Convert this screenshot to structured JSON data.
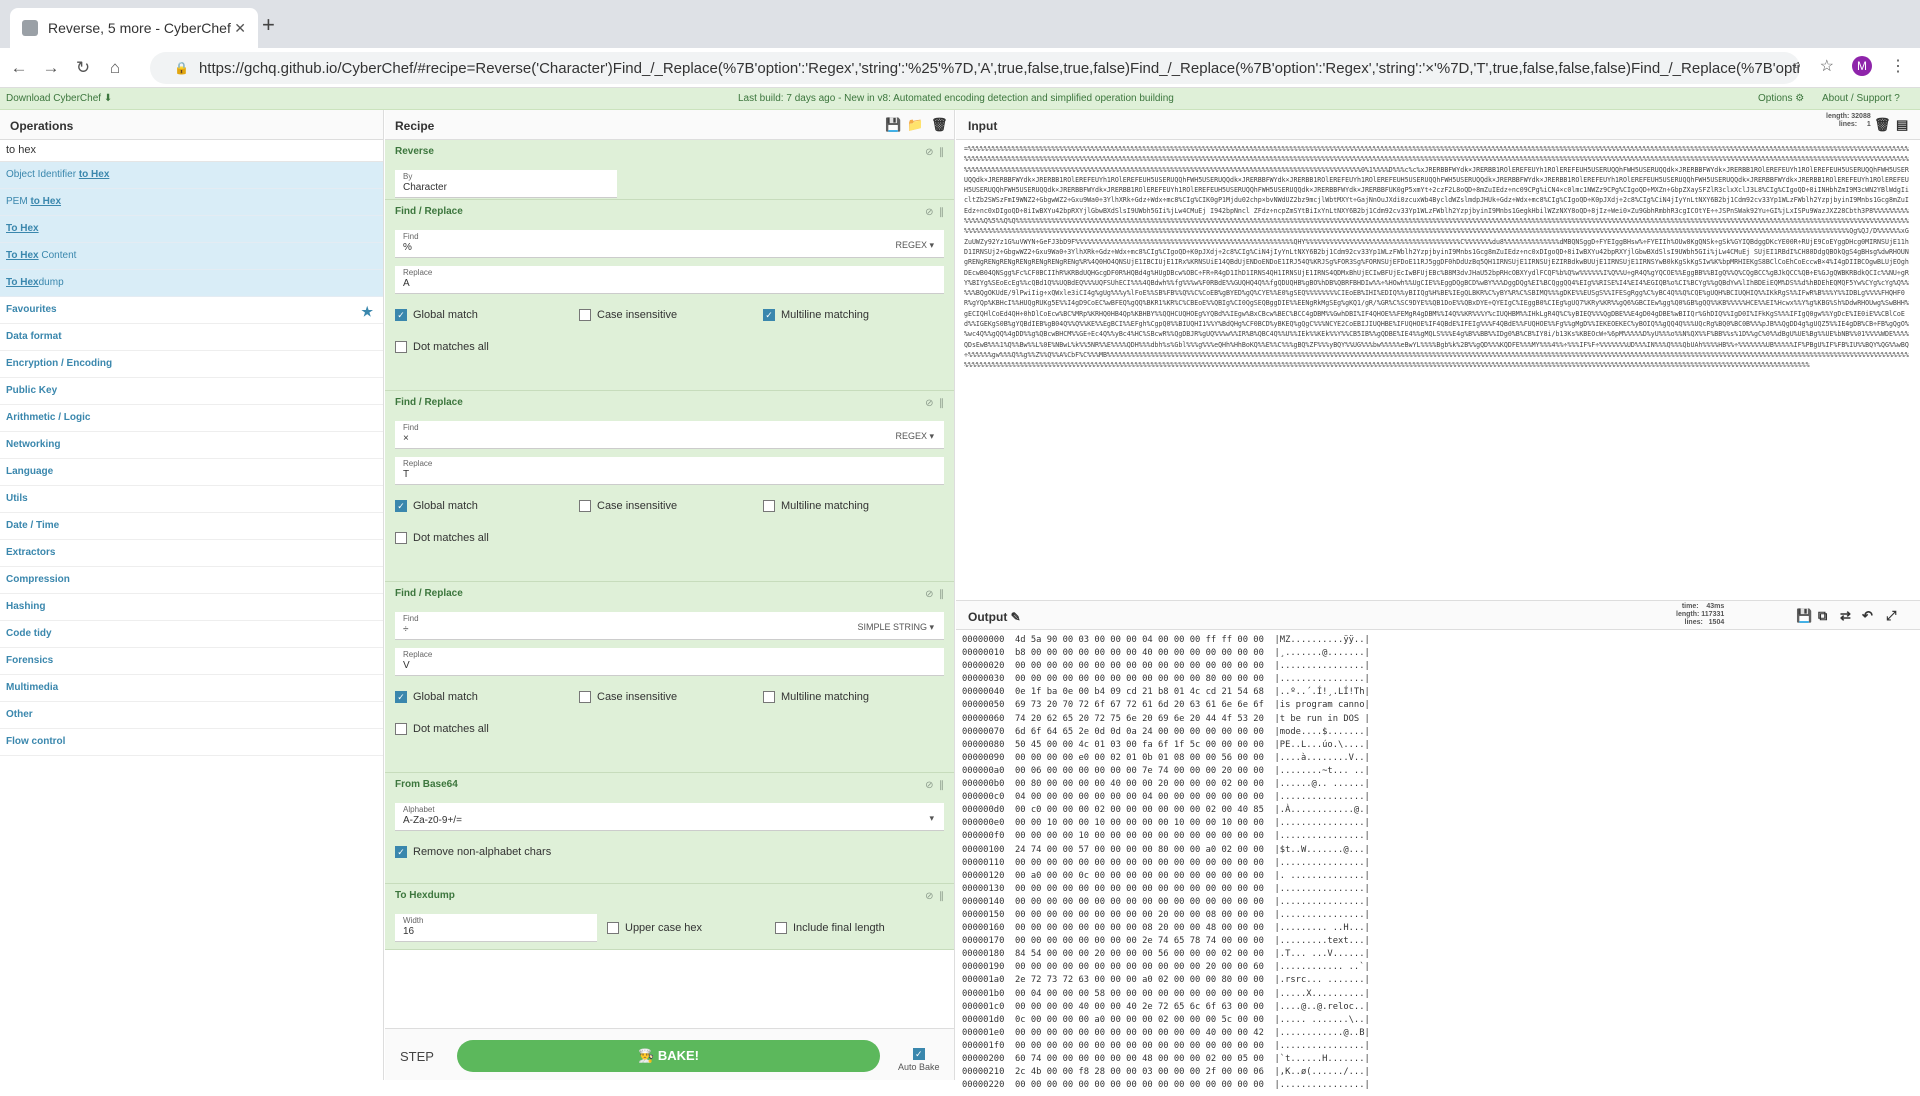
{
  "browser": {
    "tab_title": "Reverse, 5 more - CyberChef",
    "url": "https://gchq.github.io/CyberChef/#recipe=Reverse('Character')Find_/_Replace(%7B'option':'Regex','string':'%25'%7D,'A',true,false,true,false)Find_/_Replace(%7B'option':'Regex','string':'×'%7D,'T',true,false,false,false)Find_/_Replace(%7B'option':'Si...",
    "avatar": "M"
  },
  "banner": {
    "download": "Download CyberChef",
    "build": "Last build: 7 days ago - New in v8: Automated encoding detection and simplified operation building",
    "options": "Options",
    "about": "About / Support"
  },
  "operations": {
    "title": "Operations",
    "search": "to hex",
    "results": [
      {
        "pre": "Object Identifier ",
        "match": "to Hex",
        "post": ""
      },
      {
        "pre": "PEM ",
        "match": "to Hex",
        "post": ""
      },
      {
        "pre": "",
        "match": "To Hex",
        "post": ""
      },
      {
        "pre": "",
        "match": "To Hex",
        "post": " Content"
      },
      {
        "pre": "",
        "match": "To Hex",
        "post": "dump"
      }
    ],
    "categories": [
      "Favourites",
      "Data format",
      "Encryption / Encoding",
      "Public Key",
      "Arithmetic / Logic",
      "Networking",
      "Language",
      "Utils",
      "Date / Time",
      "Extractors",
      "Compression",
      "Hashing",
      "Code tidy",
      "Forensics",
      "Multimedia",
      "Other",
      "Flow control"
    ]
  },
  "recipe": {
    "title": "Recipe",
    "op_reverse": {
      "name": "Reverse",
      "by_label": "By",
      "by_value": "Character"
    },
    "fr1": {
      "name": "Find / Replace",
      "find_label": "Find",
      "find": "%",
      "mode": "REGEX",
      "replace_label": "Replace",
      "replace": "A",
      "global": "Global match",
      "case": "Case insensitive",
      "multi": "Multiline matching",
      "dot": "Dot matches all"
    },
    "fr2": {
      "name": "Find / Replace",
      "find_label": "Find",
      "find": "×",
      "mode": "REGEX",
      "replace_label": "Replace",
      "replace": "T",
      "global": "Global match",
      "case": "Case insensitive",
      "multi": "Multiline matching",
      "dot": "Dot matches all"
    },
    "fr3": {
      "name": "Find / Replace",
      "find_label": "Find",
      "find": "÷",
      "mode": "SIMPLE STRING",
      "replace_label": "Replace",
      "replace": "V",
      "global": "Global match",
      "case": "Case insensitive",
      "multi": "Multiline matching",
      "dot": "Dot matches all"
    },
    "b64": {
      "name": "From Base64",
      "alpha_label": "Alphabet",
      "alpha": "A-Za-z0-9+/=",
      "remove": "Remove non-alphabet chars"
    },
    "hexd": {
      "name": "To Hexdump",
      "width_label": "Width",
      "width": "16",
      "upper": "Upper case hex",
      "final": "Include final length"
    },
    "step": "STEP",
    "bake": "BAKE!",
    "autobake": "Auto Bake"
  },
  "input": {
    "title": "Input",
    "meta": "length: 32088\nlines:     1",
    "text": "=%%%%%%%%%%%%%%%%%%%%%%%%%%%%%%%%%%%%%%%%%%%%%%%%%%%%%%%%%%%%%%%%%%%%%%%%%%%%%%%%%%%%%%%%%%%%%%%%%%%%%%%%%%%%%%%%%%%%%%%%%%%%%%%%%%%%%%%%%%%%%%%%%%%%%%%%%%%%%%%%%%%%%%%%%%%%%%%%%%%%%%%%%%%%%%%%%%%%%%%%%%%%%%%%%%%%%%%%%%%%%%%%%%%%%%%%%%%%%%%%%%%%%%%%%%%%%%%%%%%%%%%%%%%%%%%%%%%%%%%%%%%%%%%%%%%%%%%%%%%%%%%%%%%%%%%%%%%%%%%%%%%%%%%%%%%%%%%%%%%%%%%%%%%%%%%%%%%%%%%%%%%%%%%%%%%%%%%%%%%%%%%%%%%%%%%%%%%%%%%%%%%%%%%%%%%%%%%%%%%%%%%%%%%%%%%%%%%%%%%%%%%%%%%%%%%%%%%%%%%%%%%%%%%%%%%%%%%%%%%%%%%%%%%%%%%%%%%%%%%%%%%%%%%%%%%%%%%%%%%%%%%%%%%%%%%%%%%%%%%%%%%%%%%%%%%%%%%%%%%%%%%%%%%%%%%%%%%0%1%%%%D%%%c%c%xJRERBBFWYdk×JRERBB1ROlEREFEUYh1ROlEREFEUH5USERUQQhFWH5USERUQQdk×JRERBBFWYdk×JRERBB1ROlEREFEUYh1ROlEREFEUH5USERUQQhFWH5USERUQQdk×JRERBBFWYdk×JRERBB1ROlEREFEUYh1ROlEREFEUH5USERUQQhFWH5USERUQQdk×JRERBBFWYdk×JRERBB1ROlEREFEUYh1ROlEREFEUH5USERUQQhFWH5USERUQQdk×JRERBBFWYdk×JRERBB1ROlEREFEUYh1ROlEREFEUH5USERUQQhFWH5USERUQQdk×JRERBBFWYdk×JRERBB1ROlEREFEUYh1ROlEREFEUH5USERUQQhFWH5USERUQQdk×JRERBBFWYdk×JRERBB1ROlEREFEUYh1ROlEREFEUH5USERUQQhFWH5USERUQQdk×JRERBBFWYdk×JRERBBFUK0gP5xmYt÷2czF2L8oQD÷8mZuIEdz÷nc09CPg%iCN4×c0lmc1NWZz9CPg%CIgoQD÷MXZn÷GbpZXaySFZlR3clxXclJ3L8%CIg%CIgoQD÷8iINHbhZmI9M3cWN2YBlWdgIicltZb2SWSzFmI9WNZ2÷GbgwWZ2÷Gxu9Wa0÷3YlhXRk÷Gdz÷Wdx÷mc8%CIg%CIK0gP1Mjdu02chp×bvNWdUZ2bz9mcjlWbtMXYt÷GajNnOuJXdi0zcuxWb4BycldWZslmdpJHUk÷Gdz÷Wdx÷mc8%CIg%CIgoQD÷K0pJXdj÷2c8%CIg%CiN4jIyYnLtNXY6B2bj1Cdm92cv33Yp1WLzFWblh2YzpjbyinI9Mnbs1Gcg8mZuIEdz÷nc0xDIgoQD÷8iIwBXYu42bpRXYjlGbwBXdSlsI9UWbh5GIi%jLw4CMuEj I942bpNncl ZFdz÷ncpZmSYtBiIxYnLtNXY6B2bj1Cdm92cv33Yp1WLzFWblh2YzpjbyinI9Mnbs1GegkHbilWZzNXY8oQD÷8jIz÷Wei0×Zu9GbhRmbhR3cgICOtYE÷÷JSPnSWak92Yu÷GI%jLxISPu9WazJXZ28Cbth3P8%%%%%%%%%%%%%%Q%5%%Q%Q%%%%%%%%%%%%%%%%%%%%%%%%%%%%%%%%%%%%%%%%%%%%%%%%%%%%%%%%%%%%%%%%%%%%%%%%%%%%%%%%%%%%%%%%%%%%%%%%%%%%%%%%%%%%%%%%%%%%%%%%%%%%%%%%%%%%%%%%%%%%%%%%%%%%%%%%%%%%%%%%%%%%%%%%%%%%%%%%%%%%%%%%%%%%%%%%%%%%%%%%%%%%%%%%%%%%%%%%%%%%%%%%%%%%%%%%%%%%%%%%%%%%%%%%%%%%%%%%%%%%%%%%%%%%%%%%%%%%%%%%%%%%%%%%%%%%%%%%%%%%%%%%%%%%%%%%%%%%%%%%%%%%%%%%%%%%%%%%%%%%%%%%%%%%%%%%%%%%%%%%%%%%%%%%%%%%%%%%%%%%%%%%%%%%%%%%%%%%%%%%%%%%%%%%%%%%%%%%%%%%%%%%%%%%%%%%%%%%%%%%%%%%%%%%Qg%QJ/D%%%%%%xGZuUWZy92Yz1G%uVWYN÷GeFJ3bD9F%%%%%%%%%%%%%%%%%%%%%%%%%%%%%%%%%%%%%%%%%%%%%%%%%%%%%%%QHY%%%%%%%%%%%%%%%%%%%%%%%%%%%%%%%%%%%%%%%C%%%%%%%du8%%%%%%%%%%%%%%dMBQNSggD÷FYEIggBHsw%÷FYEIIh%OUw8KgQNSk÷gSk%GYIQBdggDKcYE00R÷RUjE9CoEYggDHcg0MIRNSUjE11hD1IRNSUj2÷GbgwWZ2÷Gxu9Wa0÷3YlhXRk÷Gdz÷Wdx÷mc8%CIg%CIgoQD÷K0pJXdj÷2c8%CIg%CiN4jIyYnLtNXY6B2bj1Cdm92cv33Yp1WLzFWblh2YzpjbyinI9Mnbs1Gcg8mZuIEdz÷nc0xDIgoQD÷8iIwBXYu42bpRXYjlGbwBXdSlsI9UWbh5GIi%jLw4CMuEj SUjEI1RBdI%CH80DdgQBOkQgS4gBHsg%dwRHOUNgRENgRENgRENgRENgRENgRENgRENg%R%4Q0HO4QNSUjE1IBCIUjE1IRx%KRNSUiE14QBdUjENDoENDoE1IRJ54Q%KRJSg%FOR3Sg%FORNSUjEFDoE11RJ5ggDF0hDdUzBq5QH1IRNSUjE1IRNSUjEZIRBdkwBUUjE1IRNSUjE1IRNSYwB0kKgSkKgSIw%K%bpMRHIEKgS8BClCoEhCoEccwB×4%I4gDIIBCOgwBLUjEOghDEcwB04QNSgg%Fc%CF0BCIIhR%KRBdUQHGcgDF0R%HQBd4g%HUgDBcw%OBC÷FR÷R4gD1IhD1IRNS4QH1IRNSUjE1IRNS4QDMxBhUjECIwBFUjEcIwBFUjEBc%B8M3dvJHaU52bpRHcOBXYydlFCQF%b%Q%w%%%%%%I%Q%%U÷gR4Q%gYQCOE%%EggBB%%BIgQ%%Q%CQgBCC%gBJkQCC%QB÷E%GJgQWBKRBdkQCIc%%NU÷gRY%BIYg%SEoEcEg%%cQBd1Q%%UQBdEQ%%%UQFSUhECI%%%4QBdwh%%fg%%%w%F0RBdE%%GUQHQ4Q%%fgQDUQHB%gBO%hDB%QBRFBHDIw%%÷%HOwh%%UgCIE%%EggDQgBCD%wBY%%%DggDQg%EI%BCQggQQ4%EIg%%RISE%I4%EI4%EGIQB%o%CI%BCYg%%gQBdYw%lIhBDEiEQM%DS%%d%hBDEhEQMQF5Yw%CYg%cYg%Q%%%%%BQgOKUdE/9lPwiIig÷xQWxle3iCI4g%gUg%%%y%lFoE%%SB%FB%%Q%%C%CoEB%gBYED%gQ%CYE%%E0%gSEQ%%%%%%%%CIEoEB%IHI%EDIQ%%yBIIQg%H%BE%IEgQLBKR%C%yBY%R%C%SBIMQ%%%gDKE%%EUSgS%%IFESgRgg%C%yBC4Q%%Q%CQE%gUQH%BCIUQHIQ%%IKkRgS%%IFwR%B%%%Y%%IDBLg%%%%FHQHF0R%gYQp%KBHcI%%HUQgRUKg5E%%I4gD9CoEC%wBFEQ%gQQ%BKR1%KR%C%CBEoE%%QBIg%CI0QgSEQBggDIE%%EENgRkMgSEg%gKQ1/gR/%GR%C%SC9DYE%%QB1DoE%%QBxDYE÷QYEIgC%IEggB0%CIEg%gUQ7%KRy%KR%%gQ6%GBCIEw%gg%Q0%GB%gQQ%%KB%%%%%HCE%%EI%Hcwx%%Y%g%KBG%Sh%DdwRHOUwg%SwBHH%gECIQHlCoEd4QH÷0hDlCoEcw%BC%MRp%KRHQ0HB4Qp%KBHBY%%QQHCUQHOEg%YQBd%%IEgw%BxCBcw%BEC%BCC4gDBM%%GwhDBI%IF4QHOE%%FEMgR4gDBM%%I4Q%%KR%%%Y%cIUQHBM%%IHkLgR4Q%C%yBIEQ%%%QgDBE%%E4gD04gDBE%wBIIQr%GhDIQ%%IgD0I%IFkKgS%%%IFIgQ0gw%%YgDcE%IE0iE%%CBlCoEd%%IGEKgS0B%gYQBdIEB%gB04Q%%Q%%KE%%EgBCI%%EFgh%CgpQ0%%BIUQHI1%%Y%BdQHg%CF0BCD%yBKEQ%gQgC%%%NCYE2CoEBIJIUQHBE%IFUQHOE%IF4QBdE%IFEIg%%%F4QBdE%%FUQHOE%%Fg%%gMgD%%IEKEOEKEC%yBOIQ%%gQQ4Q%%%UQcRg%BQ0%BC0B%%%pJB%%QgDD4g%gUQZ5%%IE4gDB%CB÷FB%gQgO%%wc4Q%%gQQ%4gDD%%g%QBcwBHCM%%GE÷Ec4Q%%yBc4%HC%SBcwR%%QgDBJR%gUQ%%%w%%IR%B%QBC4Q%%U%%IEk%%KEk%%Y%%CB5IB%%gQDBE%IE4%%gMQLS%%%E4g%B%%BB%%IDg0%B%CB%IY8i/b13Ks%KBEOcW÷%6pM%%%%%D%yU%%%o%%N%QX%%F%BB%%s%1D%%gC%0%%dBgU%UE%Bg%%UE%bNB%%01%%%%WDE%%%%QDsEwB%%%1%Q%%Bw%%L%0E%NBwL%k%%5NR%%E%%%%QDH%%%dbh%s%Gbl%%%g%%%eQHh%HhBoKQ%%E%%C%%%gBQ%ZF%%%yBQY%%UG%%%bw%%%%%eBwYL%%%%Bgb%k%2B%%gQD%%%KQDFE%%%MY%%%4%%÷%%%IF%F÷%%%%%%%UD%%%IN%%%Q%%%QbUAh%%%%HB%%÷%%%%%%%UB%%%%%IF%PBgU%IF%FB%IU%%BQY%QG%%wBQ÷%%%%%%gw%%%Q%%g%%Z%%Q%%A%CbF%C%%%MB%%%%%%%%%%%%%%%%%%%%%%%%%%%%%%%%%%%%%%%%%%%%%%%%%%%%%%%%%%%%%%%%%%%%%%%%%%%%%%%%%%%%%%%%%%%%%%%%%%%%%%%%%%%%%%%%%%%%%%%%%%%%%%%%%%%%%%%%%%%%%%%%%%%%%%%%%%%%%%%%%%%%%%%%%%%%%%%%%%%%%%%%%%%%%%%%%%%%%%%%%%%%%%%%%%%%%%%%%%%%%%%%%%%%%%%%%%%%%%%%%%%%%%%%%%%%%%%%%%%%%%%%%%%%%%%%%%%%%%%%%%%%%%%%%%%%%%%%%%%%%%%%%%%%%%%%%%%%%%%%%%%%%%%%%%%%%%%%%%%%%%%%%%%%%%%%%%%%%%%%%%%%%%%%%%%%%%%%%%%%%%%%%%%%%%%%%%%%%%%%%%%%%%%%%%%%%%%"
  },
  "output": {
    "title": "Output",
    "meta": "time:    43ms\nlength: 117331\nlines:   1504",
    "lines": [
      "00000000  4d 5a 90 00 03 00 00 00 04 00 00 00 ff ff 00 00  |MZ..........ÿÿ..|",
      "00000010  b8 00 00 00 00 00 00 00 40 00 00 00 00 00 00 00  |¸.......@.......|",
      "00000020  00 00 00 00 00 00 00 00 00 00 00 00 00 00 00 00  |................|",
      "00000030  00 00 00 00 00 00 00 00 00 00 00 00 80 00 00 00  |................|",
      "00000040  0e 1f ba 0e 00 b4 09 cd 21 b8 01 4c cd 21 54 68  |..º..´.Í!¸.LÍ!Th|",
      "00000050  69 73 20 70 72 6f 67 72 61 6d 20 63 61 6e 6e 6f  |is program canno|",
      "00000060  74 20 62 65 20 72 75 6e 20 69 6e 20 44 4f 53 20  |t be run in DOS |",
      "00000070  6d 6f 64 65 2e 0d 0d 0a 24 00 00 00 00 00 00 00  |mode....$.......|",
      "00000080  50 45 00 00 4c 01 03 00 fa 6f 1f 5c 00 00 00 00  |PE..L...úo.\\....|",
      "00000090  00 00 00 00 e0 00 02 01 0b 01 08 00 00 56 00 00  |....à........V..|",
      "000000a0  00 06 00 00 00 00 00 00 7e 74 00 00 00 20 00 00  |........~t... ..|",
      "000000b0  00 80 00 00 00 00 40 00 00 20 00 00 00 02 00 00  |......@.. ......|",
      "000000c0  04 00 00 00 00 00 00 00 04 00 00 00 00 00 00 00  |................|",
      "000000d0  00 c0 00 00 00 02 00 00 00 00 00 00 02 00 40 85  |.À............@.|",
      "000000e0  00 00 10 00 00 10 00 00 00 00 10 00 00 10 00 00  |................|",
      "000000f0  00 00 00 00 10 00 00 00 00 00 00 00 00 00 00 00  |................|",
      "00000100  24 74 00 00 57 00 00 00 00 80 00 00 a0 02 00 00  |$t..W.......@...|",
      "00000110  00 00 00 00 00 00 00 00 00 00 00 00 00 00 00 00  |................|",
      "00000120  00 a0 00 00 0c 00 00 00 00 00 00 00 00 00 00 00  |. ..............|",
      "00000130  00 00 00 00 00 00 00 00 00 00 00 00 00 00 00 00  |................|",
      "00000140  00 00 00 00 00 00 00 00 00 00 00 00 00 00 00 00  |................|",
      "00000150  00 00 00 00 00 00 00 00 00 20 00 00 08 00 00 00  |................|",
      "00000160  00 00 00 00 00 00 00 00 08 20 00 00 48 00 00 00  |......... ..H...|",
      "00000170  00 00 00 00 00 00 00 00 2e 74 65 78 74 00 00 00  |.........text...|",
      "00000180  84 54 00 00 00 20 00 00 00 56 00 00 00 02 00 00  |.T... ...V......|",
      "00000190  00 00 00 00 00 00 00 00 00 00 00 00 20 00 00 60  |............ ..`|",
      "000001a0  2e 72 73 72 63 00 00 00 a0 02 00 00 00 80 00 00  |.rsrc... .......|",
      "000001b0  00 04 00 00 00 58 00 00 00 00 00 00 00 00 00 00  |.....X..........|",
      "000001c0  00 00 00 00 40 00 00 40 2e 72 65 6c 6f 63 00 00  |....@..@.reloc..|",
      "000001d0  0c 00 00 00 00 a0 00 00 00 02 00 00 00 5c 00 00  |..... .......\\..|",
      "000001e0  00 00 00 00 00 00 00 00 00 00 00 00 40 00 00 42  |............@..B|",
      "000001f0  00 00 00 00 00 00 00 00 00 00 00 00 00 00 00 00  |................|",
      "00000200  60 74 00 00 00 00 00 00 48 00 00 00 02 00 05 00  |`t......H.......|",
      "00000210  2c 4b 00 00 f8 28 00 00 03 00 00 00 2f 00 00 06  |,K..ø(....../...|",
      "00000220  00 00 00 00 00 00 00 00 00 00 00 00 00 00 00 00  |................|"
    ]
  }
}
